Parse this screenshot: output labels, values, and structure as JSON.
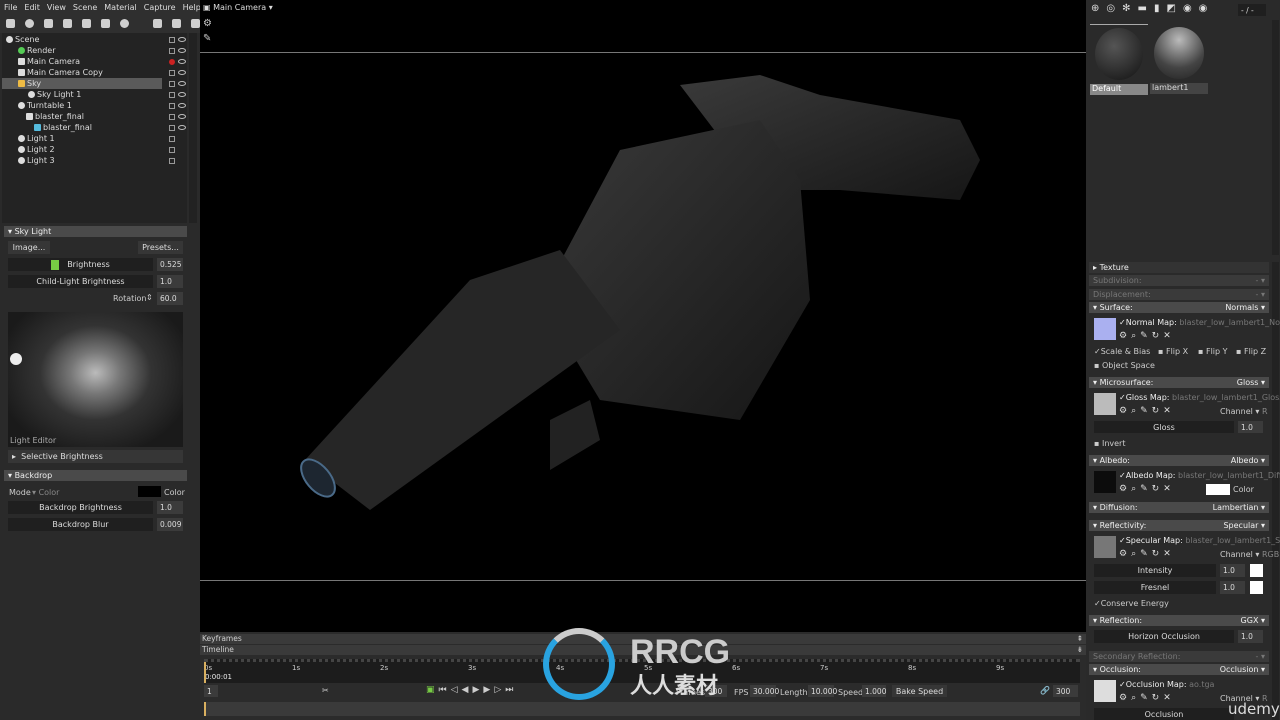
{
  "menu": [
    "File",
    "Edit",
    "View",
    "Scene",
    "Material",
    "Capture",
    "Help"
  ],
  "scene_tree": [
    {
      "label": "Scene",
      "indent": 0
    },
    {
      "label": "Render",
      "indent": 1
    },
    {
      "label": "Main Camera",
      "indent": 1
    },
    {
      "label": "Main Camera Copy",
      "indent": 1
    },
    {
      "label": "Sky",
      "indent": 1,
      "selected": true
    },
    {
      "label": "Sky Light 1",
      "indent": 2
    },
    {
      "label": "Turntable 1",
      "indent": 1
    },
    {
      "label": "blaster_final",
      "indent": 2
    },
    {
      "label": "blaster_final",
      "indent": 3
    },
    {
      "label": "Light 1",
      "indent": 1
    },
    {
      "label": "Light 2",
      "indent": 1
    },
    {
      "label": "Light 3",
      "indent": 1
    }
  ],
  "sky_light": {
    "title": "Sky Light",
    "image_button": "Image...",
    "presets_button": "Presets...",
    "brightness_label": "Brightness",
    "brightness": "0.525",
    "child_label": "Child-Light Brightness",
    "child": "1.0",
    "rotation_label": "Rotation",
    "rotation": "60.0",
    "light_editor": "Light Editor",
    "selective": "Selective Brightness"
  },
  "backdrop": {
    "title": "Backdrop",
    "mode_label": "Mode",
    "mode_value": "Color",
    "color_label": "Color",
    "color": "#000000",
    "brightness_label": "Backdrop Brightness",
    "brightness": "1.0",
    "blur_label": "Backdrop Blur",
    "blur": "0.009"
  },
  "viewport": {
    "camera": "Main Camera"
  },
  "timeline": {
    "keyframes": "Keyframes",
    "timeline": "Timeline",
    "ticks": [
      "0s",
      "1s",
      "2s",
      "3s",
      "4s",
      "5s",
      "6s",
      "7s",
      "8s",
      "9s"
    ],
    "current_time": "0:00:01",
    "frame": "1",
    "frames_label": "Frames",
    "frames": "300",
    "fps_label": "FPS",
    "fps": "30.000",
    "length_label": "Length",
    "length": "10.000",
    "speed_label": "Speed",
    "speed": "1.000",
    "bake_speed": "Bake Speed",
    "end_frame": "300"
  },
  "materials": {
    "counter": "- / -",
    "items": [
      "Default",
      "lambert1"
    ]
  },
  "props": {
    "texture": "Texture",
    "subdivision": "Subdivision:",
    "displacement": "Displacement:",
    "surface": "Surface:",
    "surface_mode": "Normals",
    "normal_map_label": "Normal Map:",
    "normal_map": "blaster_low_lambert1_Normal",
    "scale_bias": "Scale & Bias",
    "flip_x": "Flip X",
    "flip_y": "Flip Y",
    "flip_z": "Flip Z",
    "object_space": "Object Space",
    "microsurface": "Microsurface:",
    "micro_mode": "Gloss",
    "gloss_map_label": "Gloss Map:",
    "gloss_map": "blaster_low_lambert1_Glossiness",
    "channel_label": "Channel",
    "channel_r": "R",
    "gloss_label": "Gloss",
    "gloss": "1.0",
    "invert": "Invert",
    "albedo": "Albedo:",
    "albedo_mode": "Albedo",
    "albedo_map_label": "Albedo Map:",
    "albedo_map": "blaster_low_lambert1_Diffuse",
    "color_label": "Color",
    "diffusion": "Diffusion:",
    "diffusion_mode": "Lambertian",
    "reflectivity": "Reflectivity:",
    "reflectivity_mode": "Specular",
    "spec_map_label": "Specular Map:",
    "spec_map": "blaster_low_lambert1_Specular",
    "channel_rgb": "RGB",
    "intensity_label": "Intensity",
    "intensity": "1.0",
    "fresnel_label": "Fresnel",
    "fresnel": "1.0",
    "conserve": "Conserve Energy",
    "reflection": "Reflection:",
    "reflection_mode": "GGX",
    "horizon_label": "Horizon Occlusion",
    "horizon": "1.0",
    "secondary": "Secondary Reflection:",
    "dash": "-",
    "occlusion": "Occlusion:",
    "occlusion_mode": "Occlusion",
    "occ_map_label": "Occlusion Map:",
    "occ_map": "ao.tga",
    "occ_label": "Occlusion"
  },
  "watermark": {
    "brand": "RRCG",
    "sub": "人人素材",
    "udemy": "udemy"
  }
}
